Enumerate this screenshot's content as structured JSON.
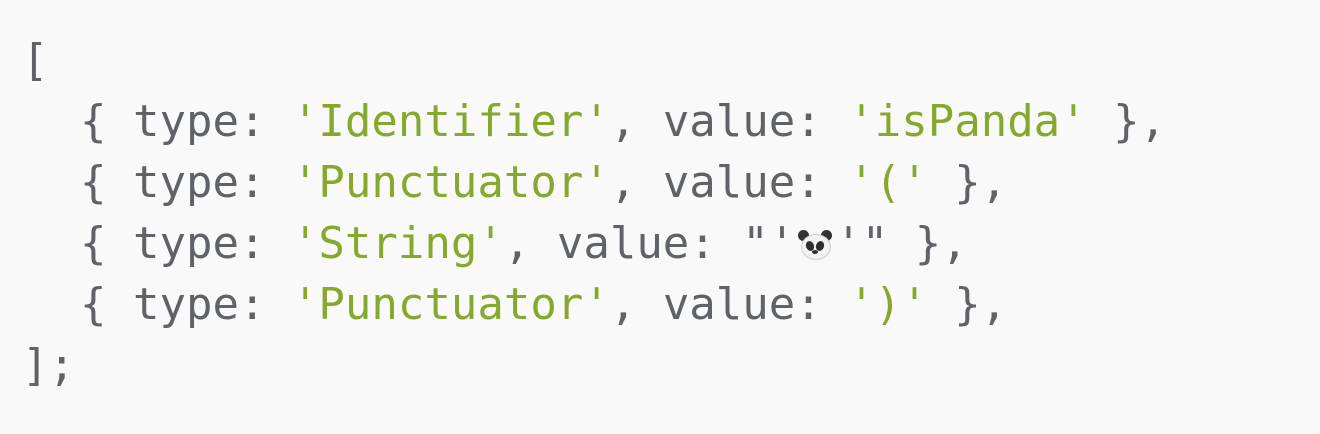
{
  "code": {
    "open_bracket": "[",
    "close_bracket": "];",
    "tokens": [
      {
        "brace_open": "{ ",
        "type_key": "type: ",
        "type_value": "'Identifier'",
        "sep": ", ",
        "value_key": "value: ",
        "value_value": "'isPanda'",
        "brace_close": " },"
      },
      {
        "brace_open": "{ ",
        "type_key": "type: ",
        "type_value": "'Punctuator'",
        "sep": ", ",
        "value_key": "value: ",
        "value_value": "'('",
        "brace_close": " },"
      },
      {
        "brace_open": "{ ",
        "type_key": "type: ",
        "type_value": "'String'",
        "sep": ", ",
        "value_key": "value: ",
        "value_prefix": "\"'",
        "value_emoji": "panda-icon",
        "value_suffix": "'\"",
        "brace_close": " },"
      },
      {
        "brace_open": "{ ",
        "type_key": "type: ",
        "type_value": "'Punctuator'",
        "sep": ", ",
        "value_key": "value: ",
        "value_value": "')'",
        "brace_close": " },"
      }
    ]
  },
  "colors": {
    "background": "#f9f9f9",
    "text": "#5f6266",
    "string": "#86a82c"
  }
}
